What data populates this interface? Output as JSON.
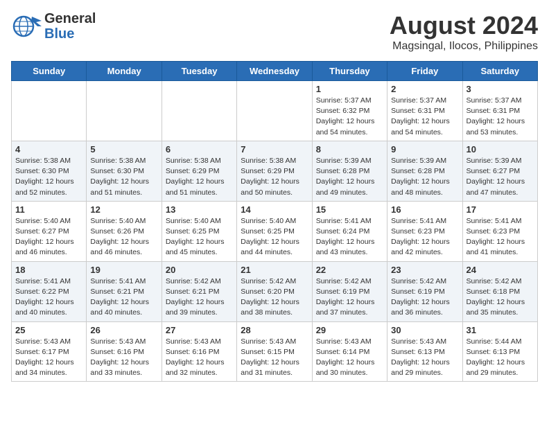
{
  "logo": {
    "line1": "General",
    "line2": "Blue"
  },
  "title": "August 2024",
  "subtitle": "Magsingal, Ilocos, Philippines",
  "days_of_week": [
    "Sunday",
    "Monday",
    "Tuesday",
    "Wednesday",
    "Thursday",
    "Friday",
    "Saturday"
  ],
  "weeks": [
    [
      {
        "day": "",
        "info": ""
      },
      {
        "day": "",
        "info": ""
      },
      {
        "day": "",
        "info": ""
      },
      {
        "day": "",
        "info": ""
      },
      {
        "day": "1",
        "info": "Sunrise: 5:37 AM\nSunset: 6:32 PM\nDaylight: 12 hours\nand 54 minutes."
      },
      {
        "day": "2",
        "info": "Sunrise: 5:37 AM\nSunset: 6:31 PM\nDaylight: 12 hours\nand 54 minutes."
      },
      {
        "day": "3",
        "info": "Sunrise: 5:37 AM\nSunset: 6:31 PM\nDaylight: 12 hours\nand 53 minutes."
      }
    ],
    [
      {
        "day": "4",
        "info": "Sunrise: 5:38 AM\nSunset: 6:30 PM\nDaylight: 12 hours\nand 52 minutes."
      },
      {
        "day": "5",
        "info": "Sunrise: 5:38 AM\nSunset: 6:30 PM\nDaylight: 12 hours\nand 51 minutes."
      },
      {
        "day": "6",
        "info": "Sunrise: 5:38 AM\nSunset: 6:29 PM\nDaylight: 12 hours\nand 51 minutes."
      },
      {
        "day": "7",
        "info": "Sunrise: 5:38 AM\nSunset: 6:29 PM\nDaylight: 12 hours\nand 50 minutes."
      },
      {
        "day": "8",
        "info": "Sunrise: 5:39 AM\nSunset: 6:28 PM\nDaylight: 12 hours\nand 49 minutes."
      },
      {
        "day": "9",
        "info": "Sunrise: 5:39 AM\nSunset: 6:28 PM\nDaylight: 12 hours\nand 48 minutes."
      },
      {
        "day": "10",
        "info": "Sunrise: 5:39 AM\nSunset: 6:27 PM\nDaylight: 12 hours\nand 47 minutes."
      }
    ],
    [
      {
        "day": "11",
        "info": "Sunrise: 5:40 AM\nSunset: 6:27 PM\nDaylight: 12 hours\nand 46 minutes."
      },
      {
        "day": "12",
        "info": "Sunrise: 5:40 AM\nSunset: 6:26 PM\nDaylight: 12 hours\nand 46 minutes."
      },
      {
        "day": "13",
        "info": "Sunrise: 5:40 AM\nSunset: 6:25 PM\nDaylight: 12 hours\nand 45 minutes."
      },
      {
        "day": "14",
        "info": "Sunrise: 5:40 AM\nSunset: 6:25 PM\nDaylight: 12 hours\nand 44 minutes."
      },
      {
        "day": "15",
        "info": "Sunrise: 5:41 AM\nSunset: 6:24 PM\nDaylight: 12 hours\nand 43 minutes."
      },
      {
        "day": "16",
        "info": "Sunrise: 5:41 AM\nSunset: 6:23 PM\nDaylight: 12 hours\nand 42 minutes."
      },
      {
        "day": "17",
        "info": "Sunrise: 5:41 AM\nSunset: 6:23 PM\nDaylight: 12 hours\nand 41 minutes."
      }
    ],
    [
      {
        "day": "18",
        "info": "Sunrise: 5:41 AM\nSunset: 6:22 PM\nDaylight: 12 hours\nand 40 minutes."
      },
      {
        "day": "19",
        "info": "Sunrise: 5:41 AM\nSunset: 6:21 PM\nDaylight: 12 hours\nand 40 minutes."
      },
      {
        "day": "20",
        "info": "Sunrise: 5:42 AM\nSunset: 6:21 PM\nDaylight: 12 hours\nand 39 minutes."
      },
      {
        "day": "21",
        "info": "Sunrise: 5:42 AM\nSunset: 6:20 PM\nDaylight: 12 hours\nand 38 minutes."
      },
      {
        "day": "22",
        "info": "Sunrise: 5:42 AM\nSunset: 6:19 PM\nDaylight: 12 hours\nand 37 minutes."
      },
      {
        "day": "23",
        "info": "Sunrise: 5:42 AM\nSunset: 6:19 PM\nDaylight: 12 hours\nand 36 minutes."
      },
      {
        "day": "24",
        "info": "Sunrise: 5:42 AM\nSunset: 6:18 PM\nDaylight: 12 hours\nand 35 minutes."
      }
    ],
    [
      {
        "day": "25",
        "info": "Sunrise: 5:43 AM\nSunset: 6:17 PM\nDaylight: 12 hours\nand 34 minutes."
      },
      {
        "day": "26",
        "info": "Sunrise: 5:43 AM\nSunset: 6:16 PM\nDaylight: 12 hours\nand 33 minutes."
      },
      {
        "day": "27",
        "info": "Sunrise: 5:43 AM\nSunset: 6:16 PM\nDaylight: 12 hours\nand 32 minutes."
      },
      {
        "day": "28",
        "info": "Sunrise: 5:43 AM\nSunset: 6:15 PM\nDaylight: 12 hours\nand 31 minutes."
      },
      {
        "day": "29",
        "info": "Sunrise: 5:43 AM\nSunset: 6:14 PM\nDaylight: 12 hours\nand 30 minutes."
      },
      {
        "day": "30",
        "info": "Sunrise: 5:43 AM\nSunset: 6:13 PM\nDaylight: 12 hours\nand 29 minutes."
      },
      {
        "day": "31",
        "info": "Sunrise: 5:44 AM\nSunset: 6:13 PM\nDaylight: 12 hours\nand 29 minutes."
      }
    ]
  ]
}
